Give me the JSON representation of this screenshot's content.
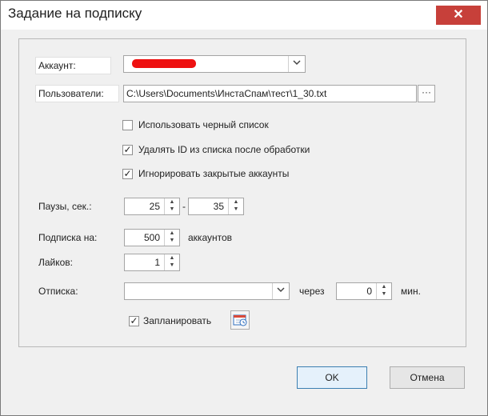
{
  "window": {
    "title": "Задание на подписку",
    "close_symbol": "✕"
  },
  "form": {
    "account": {
      "label": "Аккаунт:",
      "value_redacted": true
    },
    "users": {
      "label": "Пользователи:",
      "path": "C:\\Users\\Documents\\ИнстаСпам\\тест\\1_30.txt",
      "browse_label": "···"
    },
    "options": {
      "blacklist": {
        "label": "Использовать черный список",
        "checked": false
      },
      "delete_ids": {
        "label": "Удалять ID из списка после обработки",
        "checked": true
      },
      "ignore_private": {
        "label": "Игнорировать закрытые аккаунты",
        "checked": true
      }
    },
    "pauses": {
      "label": "Паузы, сек.:",
      "from": "25",
      "separator": "-",
      "to": "35"
    },
    "follow": {
      "label": "Подписка на:",
      "value": "500",
      "unit": "аккаунтов"
    },
    "likes": {
      "label": "Лайков:",
      "value": "1"
    },
    "unfollow": {
      "label": "Отписка:",
      "value": "",
      "through_label": "через",
      "minutes": "0",
      "unit": "мин."
    },
    "schedule": {
      "label": "Запланировать",
      "checked": true
    }
  },
  "buttons": {
    "ok": "OK",
    "cancel": "Отмена"
  },
  "icons": {
    "dropdown": "chevron-down-icon",
    "spin": "spin-updown-icon",
    "check": "✓",
    "schedule": "calendar-clock-icon"
  }
}
